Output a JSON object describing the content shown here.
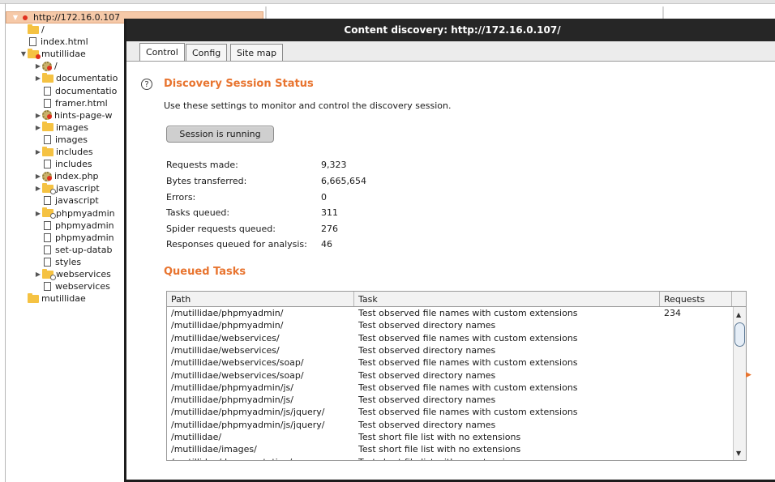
{
  "site_map": {
    "root_label": "http://172.16.0.107",
    "items": [
      {
        "label": "/",
        "icon": "folder-file-icon",
        "toggle": "",
        "indent": 1
      },
      {
        "label": "index.html",
        "icon": "file-icon",
        "toggle": "",
        "indent": 1
      },
      {
        "label": "mutillidae",
        "icon": "folder-icon",
        "toggle": "▼",
        "indent": 1
      },
      {
        "label": "/",
        "icon": "gear-icon",
        "toggle": "▶",
        "indent": 2
      },
      {
        "label": "documentatio",
        "icon": "folder-icon",
        "toggle": "▶",
        "indent": 2
      },
      {
        "label": "documentatio",
        "icon": "file-icon",
        "toggle": "",
        "indent": 2
      },
      {
        "label": "framer.html",
        "icon": "file-icon",
        "toggle": "",
        "indent": 2
      },
      {
        "label": "hints-page-w",
        "icon": "gear-icon",
        "toggle": "▶",
        "indent": 2
      },
      {
        "label": "images",
        "icon": "folder-icon",
        "toggle": "▶",
        "indent": 2
      },
      {
        "label": "images",
        "icon": "file-icon",
        "toggle": "",
        "indent": 2
      },
      {
        "label": "includes",
        "icon": "folder-icon",
        "toggle": "▶",
        "indent": 2
      },
      {
        "label": "includes",
        "icon": "file-icon",
        "toggle": "",
        "indent": 2
      },
      {
        "label": "index.php",
        "icon": "gear-icon",
        "toggle": "▶",
        "indent": 2
      },
      {
        "label": "javascript",
        "icon": "folder-icon",
        "toggle": "▶",
        "indent": 2
      },
      {
        "label": "javascript",
        "icon": "file-icon",
        "toggle": "",
        "indent": 2
      },
      {
        "label": "phpmyadmin",
        "icon": "folder-icon",
        "toggle": "▶",
        "indent": 2
      },
      {
        "label": "phpmyadmin",
        "icon": "file-icon",
        "toggle": "",
        "indent": 2
      },
      {
        "label": "phpmyadmin",
        "icon": "file-icon",
        "toggle": "",
        "indent": 2
      },
      {
        "label": "set-up-datab",
        "icon": "file-icon",
        "toggle": "",
        "indent": 2
      },
      {
        "label": "styles",
        "icon": "file-icon",
        "toggle": "",
        "indent": 2
      },
      {
        "label": "webservices",
        "icon": "folder-icon",
        "toggle": "▶",
        "indent": 2
      },
      {
        "label": "webservices",
        "icon": "file-icon",
        "toggle": "",
        "indent": 2
      },
      {
        "label": "mutillidae",
        "icon": "folder-file-icon",
        "toggle": "",
        "indent": 1
      }
    ]
  },
  "dialog": {
    "title": "Content discovery: http://172.16.0.107/",
    "tabs": [
      {
        "label": "Control",
        "active": true
      },
      {
        "label": "Config",
        "active": false
      },
      {
        "label": "Site map",
        "active": false
      }
    ],
    "help_glyph": "?",
    "status_section": {
      "title": "Discovery Session Status",
      "description": "Use these settings to monitor and control the discovery session.",
      "button_label": "Session is running"
    },
    "stats": [
      {
        "label": "Requests made:",
        "value": "9,323"
      },
      {
        "label": "Bytes transferred:",
        "value": "6,665,654"
      },
      {
        "label": "Errors:",
        "value": "0"
      },
      {
        "label": "Tasks queued:",
        "value": "311"
      },
      {
        "label": "Spider requests queued:",
        "value": "276"
      },
      {
        "label": "Responses queued for analysis:",
        "value": "46"
      }
    ],
    "queued_section": {
      "title": "Queued Tasks",
      "columns": [
        "Path",
        "Task",
        "Requests"
      ],
      "rows": [
        {
          "path": "/mutillidae/phpmyadmin/",
          "task": "Test observed file names with custom extensions",
          "requests": "234"
        },
        {
          "path": "/mutillidae/phpmyadmin/",
          "task": "Test observed directory names",
          "requests": ""
        },
        {
          "path": "/mutillidae/webservices/",
          "task": "Test observed file names with custom extensions",
          "requests": ""
        },
        {
          "path": "/mutillidae/webservices/",
          "task": "Test observed directory names",
          "requests": ""
        },
        {
          "path": "/mutillidae/webservices/soap/",
          "task": "Test observed file names with custom extensions",
          "requests": ""
        },
        {
          "path": "/mutillidae/webservices/soap/",
          "task": "Test observed directory names",
          "requests": ""
        },
        {
          "path": "/mutillidae/phpmyadmin/js/",
          "task": "Test observed file names with custom extensions",
          "requests": ""
        },
        {
          "path": "/mutillidae/phpmyadmin/js/",
          "task": "Test observed directory names",
          "requests": ""
        },
        {
          "path": "/mutillidae/phpmyadmin/js/jquery/",
          "task": "Test observed file names with custom extensions",
          "requests": ""
        },
        {
          "path": "/mutillidae/phpmyadmin/js/jquery/",
          "task": "Test observed directory names",
          "requests": ""
        },
        {
          "path": "/mutillidae/",
          "task": "Test short file list with no extensions",
          "requests": ""
        },
        {
          "path": "/mutillidae/images/",
          "task": "Test short file list with no extensions",
          "requests": ""
        },
        {
          "path": "/mutillidae/documentation/",
          "task": "Test short file list with no extensions",
          "requests": ""
        }
      ]
    },
    "scroll_up_glyph": "▲",
    "scroll_down_glyph": "▼"
  },
  "colors": {
    "accent": "#e8742f",
    "titlebar": "#262626",
    "root_highlight": "#f6c9a8",
    "folder": "#f5c242"
  }
}
